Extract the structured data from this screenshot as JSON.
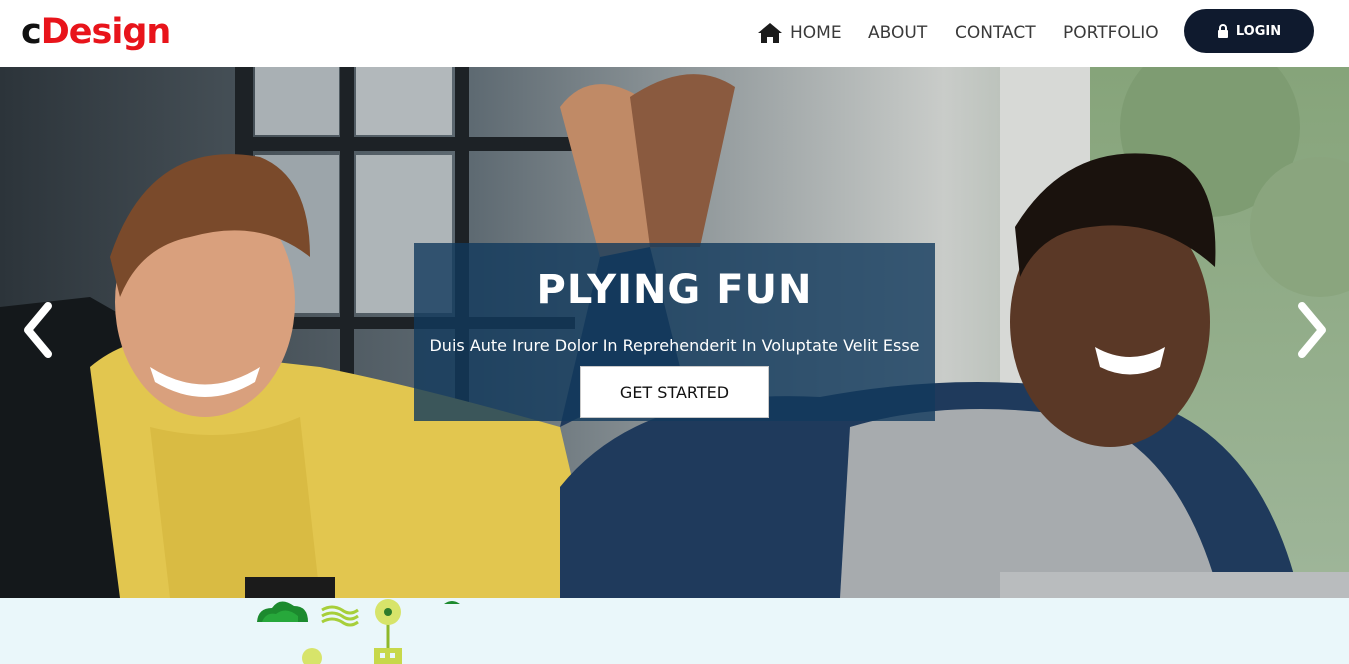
{
  "brand": {
    "prefix": "c",
    "name": "Design"
  },
  "nav": {
    "home": "HOME",
    "about": "ABOUT",
    "contact": "CONTACT",
    "portfolio": "PORTFOLIO",
    "login": "LOGIN"
  },
  "hero": {
    "title": "PLYING FUN",
    "subtitle": "Duis Aute Irure Dolor In Reprehenderit In Voluptate Velit Esse",
    "cta": "GET STARTED"
  },
  "icons": {
    "home": "home-icon",
    "login": "lock-icon",
    "prev": "chevron-left-icon",
    "next": "chevron-right-icon"
  },
  "colors": {
    "brand_red": "#e8141b",
    "navy": "#0f1a2e",
    "caption_bg": "#113a5c"
  }
}
